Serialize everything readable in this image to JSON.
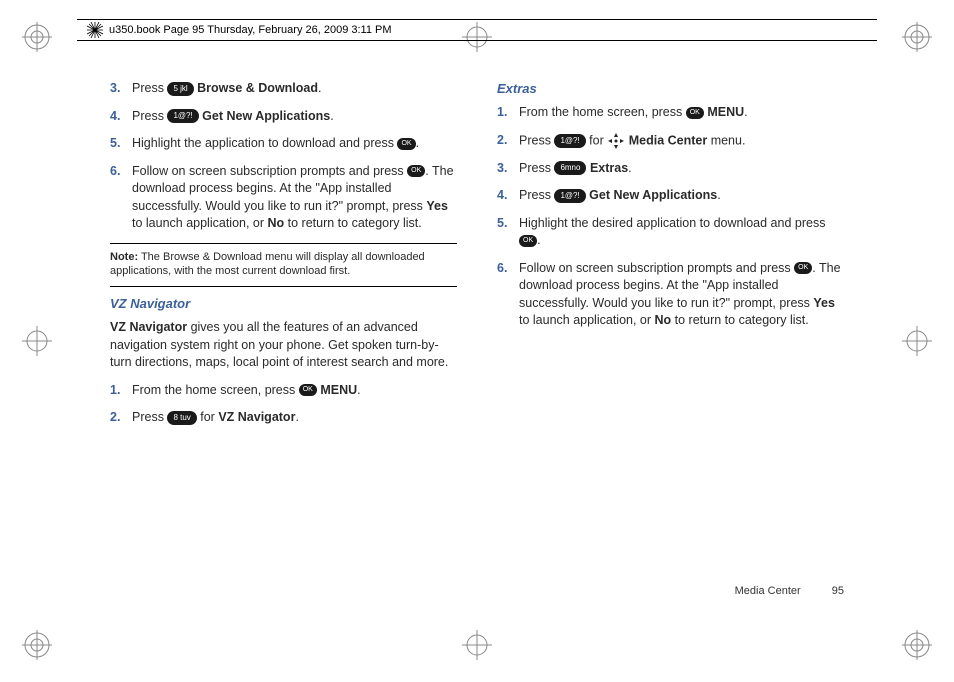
{
  "header": {
    "text": "u350.book  Page 95  Thursday, February 26, 2009  3:11 PM"
  },
  "keys": {
    "k5": "5 jkl",
    "k1_a": "1@?!",
    "k6": "6mno",
    "k8": "8 tuv",
    "k1_b": "1@?!",
    "ok": "OK"
  },
  "left": {
    "steps_a": [
      {
        "num": "3.",
        "pre": "Press ",
        "btn": "k5",
        "post": " ",
        "bold": "Browse & Download",
        "tail": "."
      },
      {
        "num": "4.",
        "pre": "Press ",
        "btn": "k1_a",
        "post": " ",
        "bold": "Get New Applications",
        "tail": "."
      },
      {
        "num": "5.",
        "text": "Highlight the application to download and press ",
        "ok": true,
        "tail": "."
      },
      {
        "num": "6.",
        "text": "Follow on screen subscription prompts and press ",
        "ok": true,
        "tail2": ". The download process begins. At the \"App installed successfully. Would you like to run it?\" prompt, press ",
        "bold1": "Yes",
        "mid": " to launch application, or ",
        "bold2": "No",
        "tail3": " to return to category list."
      }
    ],
    "note_label": "Note:",
    "note_text": " The Browse & Download menu will display all downloaded applications, with the most current download first.",
    "vz_heading": "VZ Navigator",
    "vz_intro_bold": "VZ Navigator",
    "vz_intro_rest": " gives you all the features of an advanced navigation system right on your phone. Get spoken turn-by-turn directions, maps, local point of interest search and more.",
    "steps_b": [
      {
        "num": "1.",
        "pre": "From the home screen, press ",
        "ok": true,
        "post": " ",
        "bold": "MENU",
        "tail": "."
      },
      {
        "num": "2.",
        "pre": "Press ",
        "btn": "k8",
        "post": " for ",
        "bold": "VZ Navigator",
        "tail": "."
      }
    ]
  },
  "right": {
    "extras_heading": "Extras",
    "steps": [
      {
        "num": "1.",
        "pre": "From the home screen, press ",
        "ok": true,
        "post": " ",
        "bold": "MENU",
        "tail": "."
      },
      {
        "num": "2.",
        "pre": "Press ",
        "btn": "k1_b",
        "post": " for ",
        "arrow": true,
        "bold": "Media Center",
        "tail": " menu."
      },
      {
        "num": "3.",
        "pre": "Press ",
        "btn": "k6",
        "post": " ",
        "bold": "Extras",
        "tail": "."
      },
      {
        "num": "4.",
        "pre": "Press ",
        "btn": "k1_b",
        "post": " ",
        "bold": "Get New Applications",
        "tail": "."
      },
      {
        "num": "5.",
        "text": "Highlight the desired application to download and press ",
        "ok_newline": true,
        "tail": "."
      },
      {
        "num": "6.",
        "text": "Follow on screen subscription prompts and press ",
        "ok": true,
        "tail2": ". The download process begins. At the \"App installed successfully. Would you like to run it?\" prompt, press ",
        "bold1": "Yes",
        "mid": " to launch application, or ",
        "bold2": "No",
        "tail3": " to return to category list."
      }
    ]
  },
  "footer": {
    "section": "Media Center",
    "page": "95"
  }
}
